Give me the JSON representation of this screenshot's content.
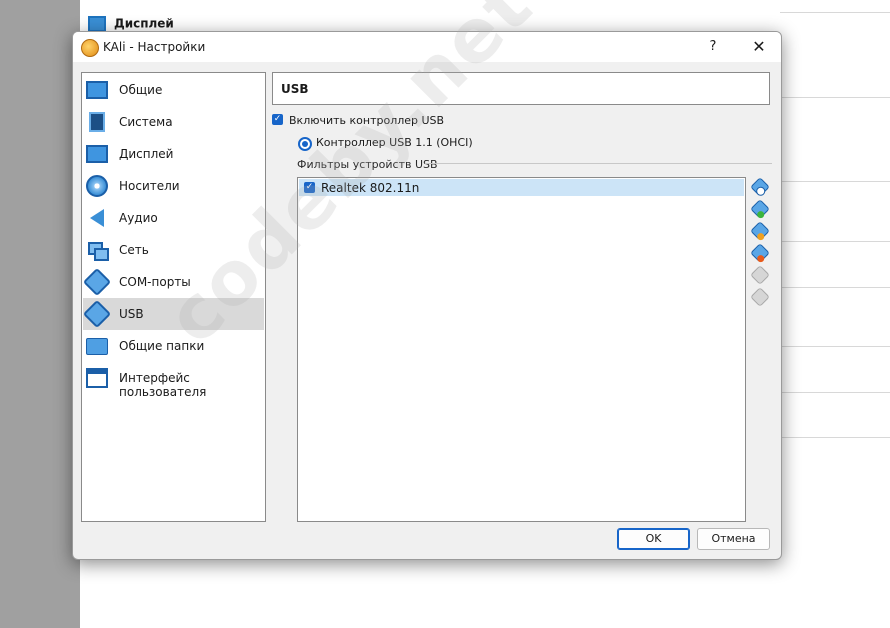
{
  "background": {
    "header_title": "Дисплей"
  },
  "dialog": {
    "title": "KAli - Настройки",
    "help_label": "?",
    "close_label": "✕"
  },
  "sidebar": {
    "items": [
      {
        "label": "Общие",
        "icon": "monitor-icon"
      },
      {
        "label": "Система",
        "icon": "chip-icon"
      },
      {
        "label": "Дисплей",
        "icon": "display-icon"
      },
      {
        "label": "Носители",
        "icon": "disc-icon"
      },
      {
        "label": "Аудио",
        "icon": "speaker-icon"
      },
      {
        "label": "Сеть",
        "icon": "network-icon"
      },
      {
        "label": "COM-порты",
        "icon": "serial-port-icon"
      },
      {
        "label": "USB",
        "icon": "usb-icon",
        "selected": true
      },
      {
        "label": "Общие папки",
        "icon": "folder-icon"
      },
      {
        "label": "Интерфейс пользователя",
        "icon": "window-icon"
      }
    ]
  },
  "usb": {
    "section_title": "USB",
    "enable_label": "Включить контроллер USB",
    "enable_checked": true,
    "controller_label": "Контроллер USB 1.1 (OHCI)",
    "filters_label": "Фильтры устройств USB",
    "filters": [
      {
        "name": "Realtek 802.11n",
        "checked": true
      }
    ],
    "tools": [
      {
        "name": "add-empty-filter-icon",
        "enabled": true
      },
      {
        "name": "add-device-filter-icon",
        "enabled": true
      },
      {
        "name": "edit-filter-icon",
        "enabled": true
      },
      {
        "name": "remove-filter-icon",
        "enabled": true
      },
      {
        "name": "move-filter-up-icon",
        "enabled": false
      },
      {
        "name": "move-filter-down-icon",
        "enabled": false
      }
    ]
  },
  "buttons": {
    "ok": "OK",
    "cancel": "Отмена"
  },
  "watermark": "codeby.net",
  "colors": {
    "accent": "#1765c9",
    "selection": "#cce4f7",
    "sidebar_selected": "#d9d9d9"
  }
}
